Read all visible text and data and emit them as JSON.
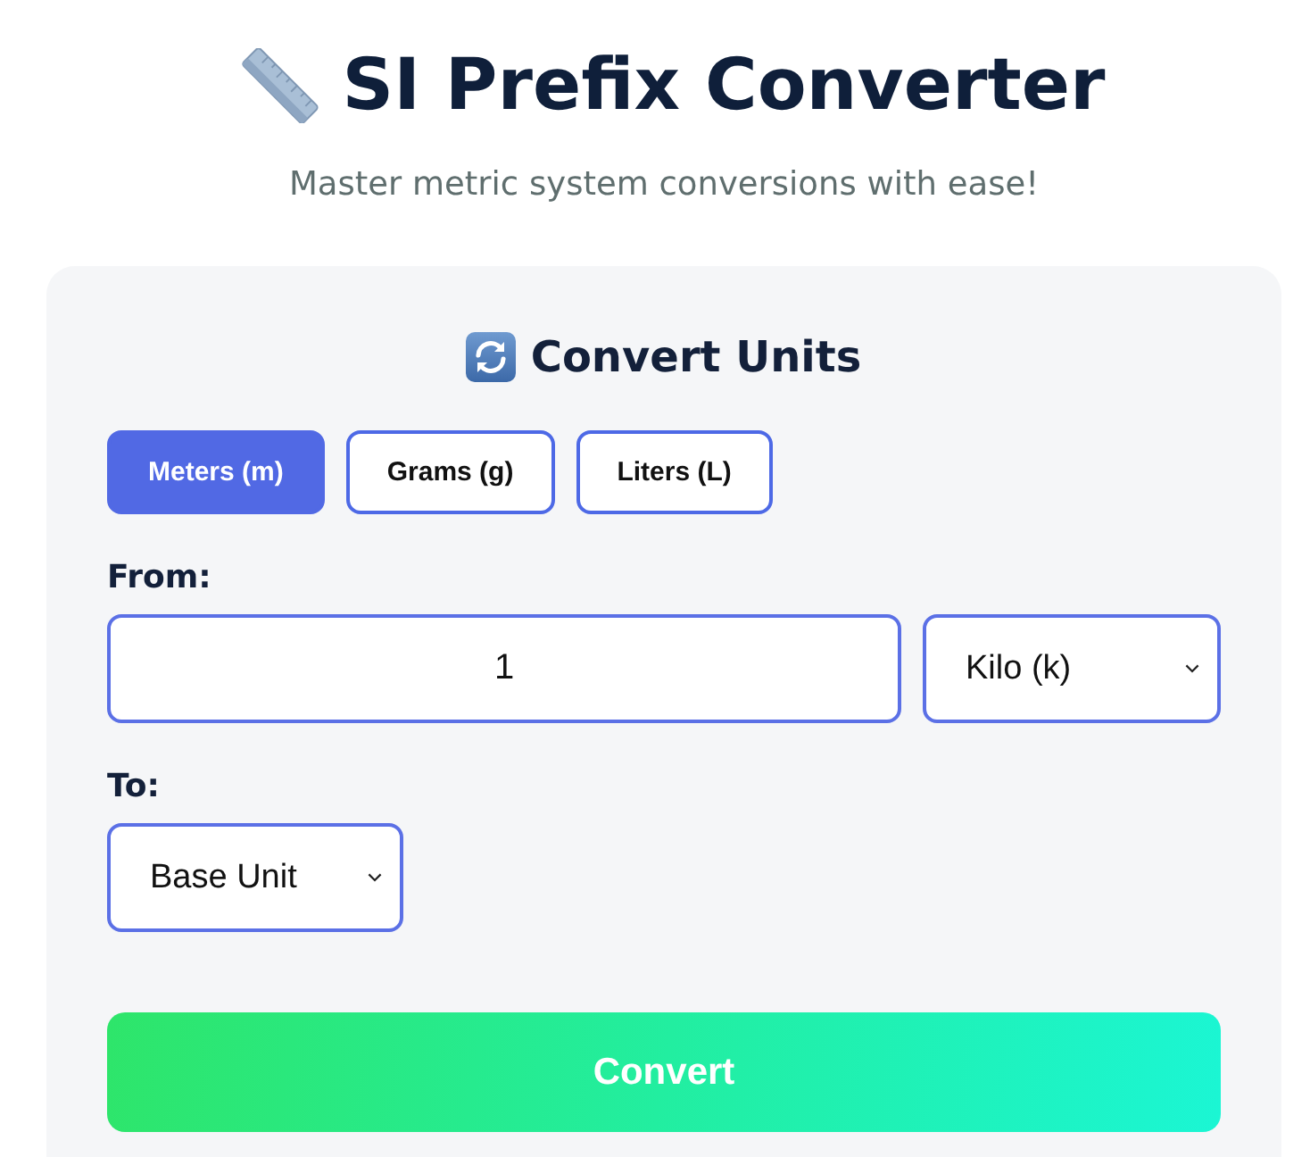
{
  "header": {
    "title": "SI Prefix Converter",
    "subtitle": "Master metric system conversions with ease!"
  },
  "converter": {
    "heading": "Convert Units",
    "unit_tabs": [
      {
        "label": "Meters (m)",
        "selected": true
      },
      {
        "label": "Grams (g)",
        "selected": false
      },
      {
        "label": "Liters (L)",
        "selected": false
      }
    ],
    "from": {
      "label": "From:",
      "value": "1",
      "prefix": "Kilo (k)"
    },
    "to": {
      "label": "To:",
      "prefix": "Base Unit"
    },
    "convert_button": "Convert"
  }
}
